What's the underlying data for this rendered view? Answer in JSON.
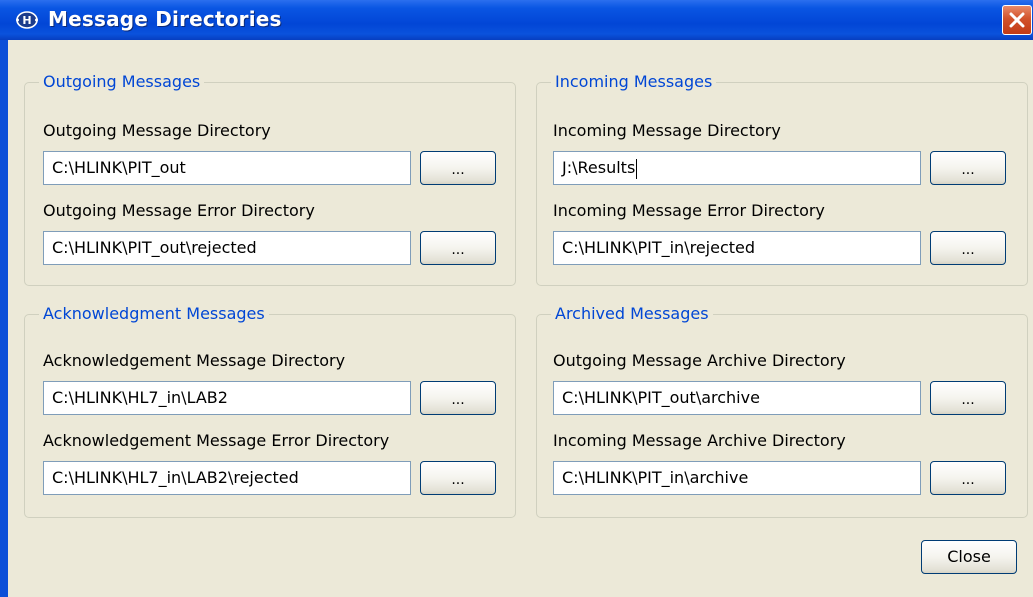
{
  "window": {
    "title": "Message Directories",
    "close_label": "Close"
  },
  "groups": {
    "outgoing": {
      "legend": "Outgoing Messages",
      "dir_label": "Outgoing Message Directory",
      "dir_value": "C:\\HLINK\\PIT_out",
      "err_label": "Outgoing Message Error Directory",
      "err_value": "C:\\HLINK\\PIT_out\\rejected"
    },
    "incoming": {
      "legend": "Incoming Messages",
      "dir_label": "Incoming Message Directory",
      "dir_value": "J:\\Results",
      "err_label": "Incoming Message Error Directory",
      "err_value": "C:\\HLINK\\PIT_in\\rejected"
    },
    "ack": {
      "legend": "Acknowledgment Messages",
      "dir_label": "Acknowledgement Message Directory",
      "dir_value": "C:\\HLINK\\HL7_in\\LAB2",
      "err_label": "Acknowledgement Message Error Directory",
      "err_value": "C:\\HLINK\\HL7_in\\LAB2\\rejected"
    },
    "archived": {
      "legend": "Archived Messages",
      "out_label": "Outgoing Message Archive Directory",
      "out_value": "C:\\HLINK\\PIT_out\\archive",
      "in_label": "Incoming Message Archive Directory",
      "in_value": "C:\\HLINK\\PIT_in\\archive"
    }
  },
  "browse_label": "...",
  "icons": {
    "app": "hlink-app-icon",
    "close": "close-icon"
  },
  "colors": {
    "titlebar": "#0a56e3",
    "legend": "#0046d5",
    "client": "#ece9d8",
    "close_button": "#d2522b"
  }
}
